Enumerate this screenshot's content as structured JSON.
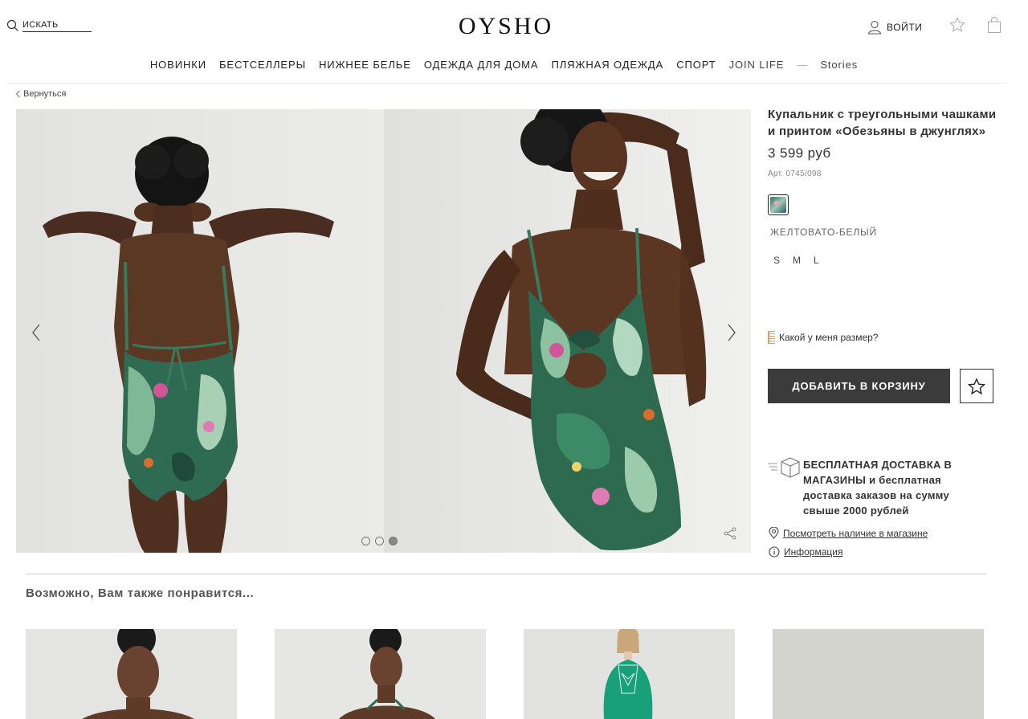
{
  "header": {
    "search_placeholder": "ИСКАТЬ",
    "logo": "OYSHO",
    "login_label": "ВОЙТИ",
    "nav": [
      {
        "label": "НОВИНКИ"
      },
      {
        "label": "БЕСТСЕЛЛЕРЫ"
      },
      {
        "label": "НИЖНЕЕ БЕЛЬЕ"
      },
      {
        "label": "ОДЕЖДА ДЛЯ ДОМА"
      },
      {
        "label": "ПЛЯЖНАЯ ОДЕЖДА"
      },
      {
        "label": "СПОРТ"
      },
      {
        "label": "JOIN LIFE"
      },
      {
        "label": "—"
      },
      {
        "label": "Stories"
      }
    ]
  },
  "back_label": "Вернуться",
  "gallery": {
    "slide_count": 3,
    "active_slide": 3
  },
  "product": {
    "title": "Купальник с треугольными чашками и принтом «Обезьяны в джунглях»",
    "price": "3 599 руб",
    "sku": "Арт. 0745/098",
    "color_name": "ЖЕЛТОВАТО-БЕЛЫЙ",
    "sizes": [
      "S",
      "M",
      "L"
    ],
    "size_guide_label": "Какой у меня размер?",
    "add_to_cart_label": "ДОБАВИТЬ В КОРЗИНУ",
    "delivery_bold": "БЕСПЛАТНАЯ ДОСТАВКА В МАГАЗИНЫ",
    "delivery_rest": "и бесплатная доставка заказов на сумму свыше 2000 рублей",
    "store_link": "Посмотреть наличие в магазине",
    "info_link": "Информация"
  },
  "recommendations": {
    "title": "Возможно, Вам также понравится..."
  },
  "colors": {
    "button_dark": "#3b3b3b",
    "accent_dash": "#c9a96e"
  }
}
